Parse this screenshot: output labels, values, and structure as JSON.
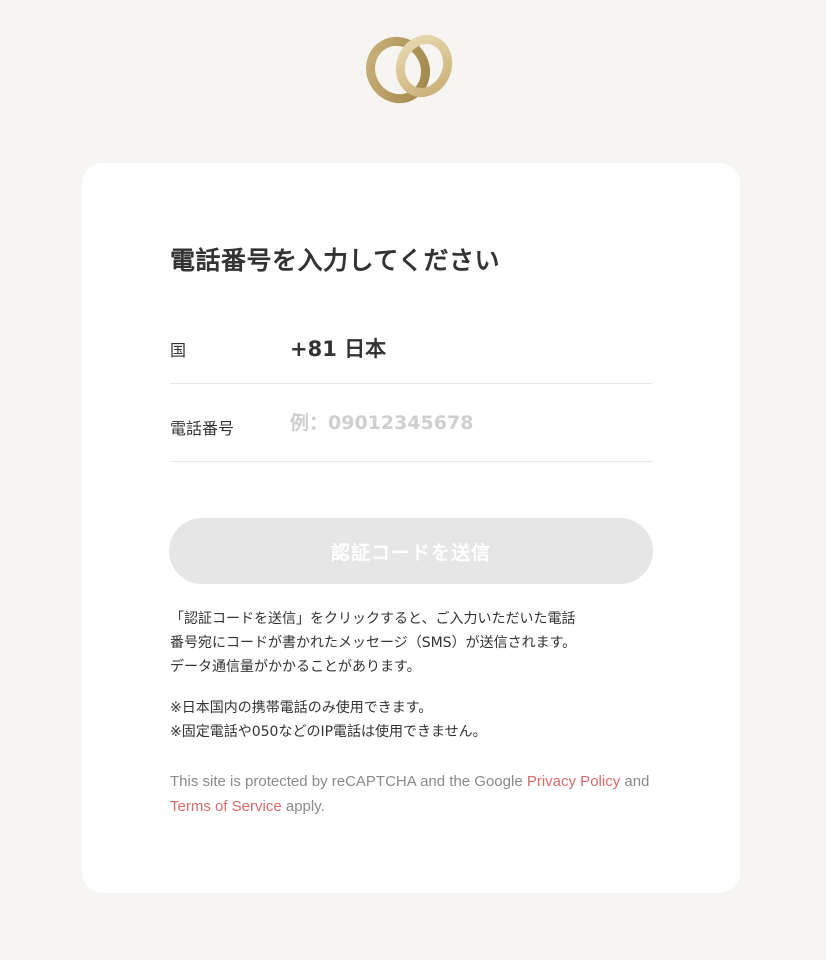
{
  "brand": {
    "logo_icon": "interlocking-rings-logo",
    "colors": {
      "gold_dark": "#b49a5c",
      "gold_light": "#e3d0a2"
    }
  },
  "form": {
    "title": "電話番号を入力してください",
    "country": {
      "label": "国",
      "value": "+81 日本"
    },
    "phone": {
      "label": "電話番号",
      "placeholder": "例：09012345678",
      "value": ""
    },
    "send_button": {
      "label": "認証コードを送信",
      "enabled": false
    }
  },
  "notices": {
    "sms": [
      "「認証コードを送信」をクリックすると、ご入力いただいた電話",
      "番号宛にコードが書かれたメッセージ（SMS）が送信されます。",
      "データ通信量がかかることがあります。"
    ],
    "mobile_only": [
      "※日本国内の携帯電話のみ使用できます。",
      "※固定電話や050などのIP電話は使用できません。"
    ]
  },
  "recaptcha": {
    "text_before": "This site is protected by reCAPTCHA and the Google ",
    "privacy_link": "Privacy Policy",
    "text_middle": " and ",
    "terms_link": "Terms of Service",
    "text_after": " apply.",
    "link_color": "#d46b6b"
  }
}
